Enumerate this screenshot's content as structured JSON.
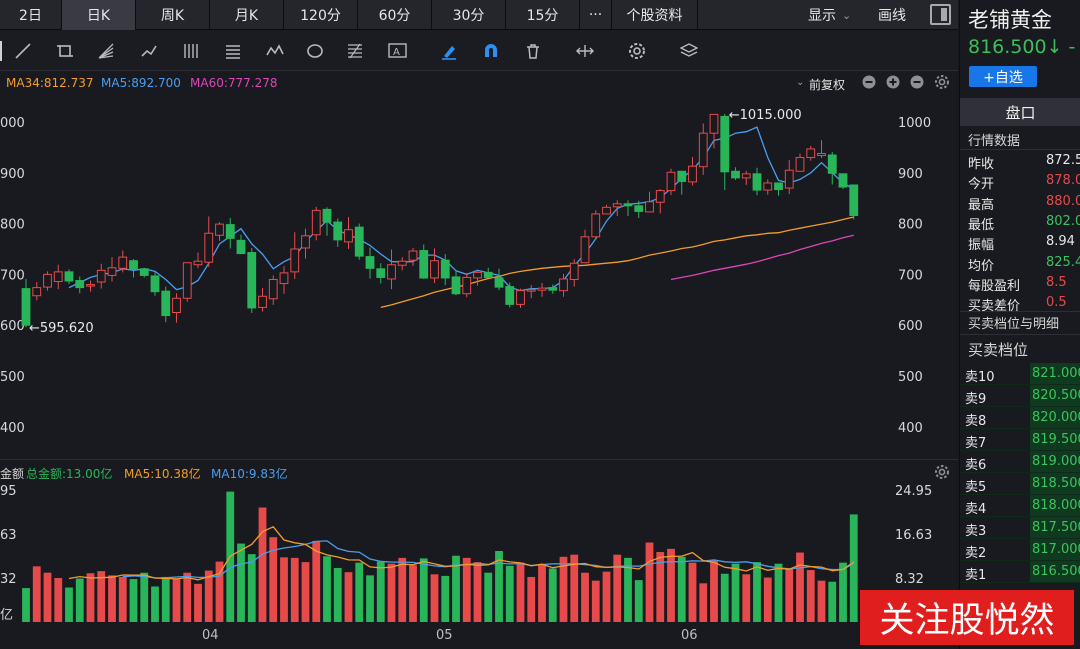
{
  "tabs": [
    "2日",
    "日K",
    "周K",
    "月K",
    "120分",
    "60分",
    "30分",
    "15分",
    "···",
    "个股资料"
  ],
  "tab_active": 1,
  "tab_right": {
    "display": "显示",
    "draw": "画线"
  },
  "ma_legend": {
    "ma34": "MA34:812.737",
    "ma5": "MA5:892.700",
    "ma60": "MA60:777.278",
    "adjust": "前复权"
  },
  "colors": {
    "up": "#e74a4a",
    "down": "#29b65a",
    "ma5": "#4a9ef0",
    "ma34": "#f39c2b",
    "ma60": "#d946b8",
    "bg": "#191a1f"
  },
  "price_axis": {
    "right": [
      "1000",
      "900",
      "800",
      "700",
      "600",
      "500",
      "400"
    ],
    "left": [
      "000",
      "900",
      "800",
      "700",
      "600",
      "500",
      "400"
    ]
  },
  "annotations": {
    "high": "1015.000",
    "low": "595.620"
  },
  "vol_legend": {
    "label": "金额",
    "total": "总金额:13.00亿",
    "ma5": "MA5:10.38亿",
    "ma10": "MA10:9.83亿"
  },
  "vol_axis": {
    "right": [
      "24.95",
      "16.63",
      "8.32"
    ],
    "left": [
      "95",
      "63",
      "32",
      "亿"
    ]
  },
  "months": [
    "04",
    "05",
    "06"
  ],
  "chart_data": {
    "type": "candlestick",
    "candles": [
      [
        672,
        600,
        691,
        596
      ],
      [
        658,
        674,
        685,
        649
      ],
      [
        675,
        700,
        706,
        668
      ],
      [
        686,
        705,
        719,
        671
      ],
      [
        705,
        687,
        710,
        681
      ],
      [
        688,
        674,
        696,
        663
      ],
      [
        678,
        680,
        688,
        666
      ],
      [
        685,
        708,
        721,
        672
      ],
      [
        698,
        713,
        734,
        686
      ],
      [
        712,
        734,
        747,
        704
      ],
      [
        727,
        710,
        730,
        694
      ],
      [
        711,
        698,
        713,
        694
      ],
      [
        697,
        666,
        704,
        658
      ],
      [
        667,
        619,
        676,
        606
      ],
      [
        625,
        653,
        663,
        605
      ],
      [
        653,
        723,
        718,
        646
      ],
      [
        719,
        726,
        743,
        712
      ],
      [
        724,
        781,
        814,
        715
      ],
      [
        777,
        799,
        803,
        766
      ],
      [
        798,
        771,
        811,
        751
      ],
      [
        767,
        741,
        778,
        751
      ],
      [
        743,
        634,
        752,
        624
      ],
      [
        635,
        657,
        673,
        627
      ],
      [
        652,
        690,
        698,
        640
      ],
      [
        682,
        703,
        716,
        662
      ],
      [
        705,
        750,
        783,
        691
      ],
      [
        752,
        776,
        790,
        731
      ],
      [
        778,
        826,
        833,
        767
      ],
      [
        828,
        803,
        832,
        776
      ],
      [
        803,
        768,
        810,
        754
      ],
      [
        764,
        788,
        813,
        750
      ],
      [
        793,
        736,
        800,
        729
      ],
      [
        735,
        712,
        753,
        692
      ],
      [
        711,
        694,
        722,
        682
      ],
      [
        691,
        719,
        749,
        671
      ],
      [
        718,
        726,
        734,
        708
      ],
      [
        728,
        746,
        752,
        717
      ],
      [
        747,
        693,
        759,
        691
      ],
      [
        693,
        727,
        751,
        683
      ],
      [
        728,
        693,
        740,
        679
      ],
      [
        695,
        662,
        708,
        659
      ],
      [
        662,
        694,
        703,
        655
      ],
      [
        693,
        704,
        709,
        678
      ],
      [
        704,
        694,
        713,
        694
      ],
      [
        693,
        675,
        711,
        669
      ],
      [
        676,
        641,
        684,
        635
      ],
      [
        641,
        668,
        672,
        634
      ],
      [
        668,
        670,
        679,
        653
      ],
      [
        669,
        673,
        683,
        656
      ],
      [
        674,
        669,
        680,
        662
      ],
      [
        668,
        691,
        701,
        656
      ],
      [
        690,
        722,
        730,
        676
      ],
      [
        723,
        774,
        788,
        722
      ],
      [
        774,
        819,
        826,
        768
      ],
      [
        819,
        832,
        837,
        827
      ],
      [
        833,
        839,
        846,
        815
      ],
      [
        839,
        835,
        846,
        815
      ],
      [
        835,
        824,
        845,
        811
      ],
      [
        823,
        843,
        863,
        826
      ],
      [
        842,
        865,
        868,
        820
      ],
      [
        865,
        901,
        908,
        856
      ],
      [
        903,
        883,
        902,
        857
      ],
      [
        882,
        913,
        931,
        875
      ],
      [
        912,
        978,
        997,
        896
      ],
      [
        978,
        1015,
        1015,
        948
      ],
      [
        1011,
        902,
        1016,
        866
      ],
      [
        903,
        890,
        911,
        886
      ],
      [
        890,
        898,
        904,
        876
      ],
      [
        898,
        866,
        910,
        856
      ],
      [
        866,
        880,
        887,
        857
      ],
      [
        880,
        867,
        874,
        855
      ],
      [
        870,
        905,
        925,
        858
      ],
      [
        903,
        930,
        938,
        925
      ],
      [
        930,
        947,
        953,
        924
      ],
      [
        934,
        938,
        964,
        929
      ],
      [
        935,
        899,
        941,
        877
      ],
      [
        898,
        872,
        895,
        868
      ],
      [
        876,
        816,
        872,
        808
      ]
    ],
    "ma5": [
      null,
      null,
      null,
      null,
      674,
      684,
      694,
      700,
      703,
      711,
      708,
      711,
      706,
      690,
      670,
      676,
      688,
      722,
      760,
      775,
      790,
      760,
      740,
      711,
      725,
      735,
      764,
      786,
      806,
      787,
      778,
      769,
      757,
      740,
      725,
      725,
      725,
      738,
      738,
      728,
      707,
      700,
      708,
      703,
      698,
      675,
      668,
      672,
      672,
      674,
      688,
      717,
      741,
      770,
      805,
      830,
      838,
      840,
      843,
      851,
      869,
      889,
      906,
      930,
      964,
      968,
      978,
      981,
      990,
      930,
      885,
      880,
      887,
      900,
      920,
      900,
      880,
      868
    ],
    "ma34": [
      null,
      null,
      null,
      null,
      null,
      null,
      null,
      null,
      null,
      null,
      null,
      null,
      null,
      null,
      null,
      null,
      null,
      null,
      null,
      null,
      null,
      null,
      null,
      null,
      null,
      null,
      null,
      null,
      null,
      null,
      null,
      null,
      null,
      635,
      640,
      646,
      652,
      658,
      665,
      670,
      675,
      680,
      686,
      692,
      696,
      702,
      706,
      709,
      712,
      714,
      716,
      717,
      718,
      720,
      722,
      724,
      727,
      732,
      738,
      742,
      746,
      751,
      754,
      759,
      765,
      768,
      772,
      776,
      778,
      781,
      782,
      787,
      791,
      795,
      799,
      803,
      808,
      813
    ],
    "ma60": [
      null,
      null,
      null,
      null,
      null,
      null,
      null,
      null,
      null,
      null,
      null,
      null,
      null,
      null,
      null,
      null,
      null,
      null,
      null,
      null,
      null,
      null,
      null,
      null,
      null,
      null,
      null,
      null,
      null,
      null,
      null,
      null,
      null,
      null,
      null,
      null,
      null,
      null,
      null,
      null,
      null,
      null,
      null,
      null,
      null,
      null,
      null,
      null,
      null,
      null,
      null,
      null,
      null,
      null,
      null,
      null,
      null,
      null,
      null,
      null,
      690,
      694,
      698,
      703,
      708,
      712,
      716,
      720,
      725,
      731,
      737,
      742,
      749,
      755,
      761,
      766,
      772,
      777
    ],
    "volume": [
      6.4,
      10.5,
      9.3,
      8.3,
      6.5,
      8.2,
      9.2,
      9.6,
      8.8,
      8.5,
      8.1,
      9.3,
      6.7,
      8.5,
      8.1,
      9.3,
      7.2,
      9.7,
      11.4,
      24.6,
      14.8,
      12.8,
      21.6,
      16.0,
      12.2,
      12.1,
      11.3,
      15.3,
      12.4,
      10.2,
      9.4,
      11.2,
      8.8,
      11.4,
      11.0,
      12.1,
      10.7,
      12.0,
      9.0,
      8.7,
      12.5,
      12.1,
      11.3,
      9.3,
      13.4,
      10.6,
      11.2,
      8.5,
      10.8,
      10.1,
      12.3,
      12.7,
      9.3,
      7.8,
      9.5,
      12.7,
      12.1,
      7.9,
      15.0,
      13.2,
      13.8,
      12.3,
      11.2,
      7.3,
      11.7,
      9.1,
      11.0,
      9.0,
      11.3,
      8.4,
      11.0,
      10.1,
      13.1,
      9.8,
      7.8,
      7.6,
      11.2,
      20.3
    ]
  },
  "right_panel": {
    "name": "老铺黄金",
    "price": "816.500↓",
    "price_change": "-",
    "add_btn": "+自选",
    "pankou": "盘口",
    "market_title": "行情数据",
    "stats": [
      {
        "label": "昨收",
        "value": "872.5",
        "color": "#e8e8e8"
      },
      {
        "label": "今开",
        "value": "878.0",
        "color": "#e74a4a"
      },
      {
        "label": "最高",
        "value": "880.0",
        "color": "#e74a4a"
      },
      {
        "label": "最低",
        "value": "802.0",
        "color": "#3dc25f"
      },
      {
        "label": "振幅",
        "value": "8.94",
        "color": "#e8e8e8"
      },
      {
        "label": "均价",
        "value": "825.4",
        "color": "#3dc25f"
      },
      {
        "label": "每股盈利",
        "value": "8.5",
        "color": "#e74a4a"
      },
      {
        "label": "买卖差价",
        "value": "0.5",
        "color": "#e74a4a"
      }
    ],
    "orderbook_title": "买卖档位与明细",
    "orderbook_sub": "买卖档位",
    "orderbook": [
      {
        "label": "卖10",
        "value": "821.000"
      },
      {
        "label": "卖9",
        "value": "820.500"
      },
      {
        "label": "卖8",
        "value": "820.000"
      },
      {
        "label": "卖7",
        "value": "819.500"
      },
      {
        "label": "卖6",
        "value": "819.000"
      },
      {
        "label": "卖5",
        "value": "818.500"
      },
      {
        "label": "卖4",
        "value": "818.000"
      },
      {
        "label": "卖3",
        "value": "817.500"
      },
      {
        "label": "卖2",
        "value": "817.000"
      },
      {
        "label": "卖1",
        "value": "816.500"
      }
    ]
  },
  "watermark": "关注股悦然"
}
